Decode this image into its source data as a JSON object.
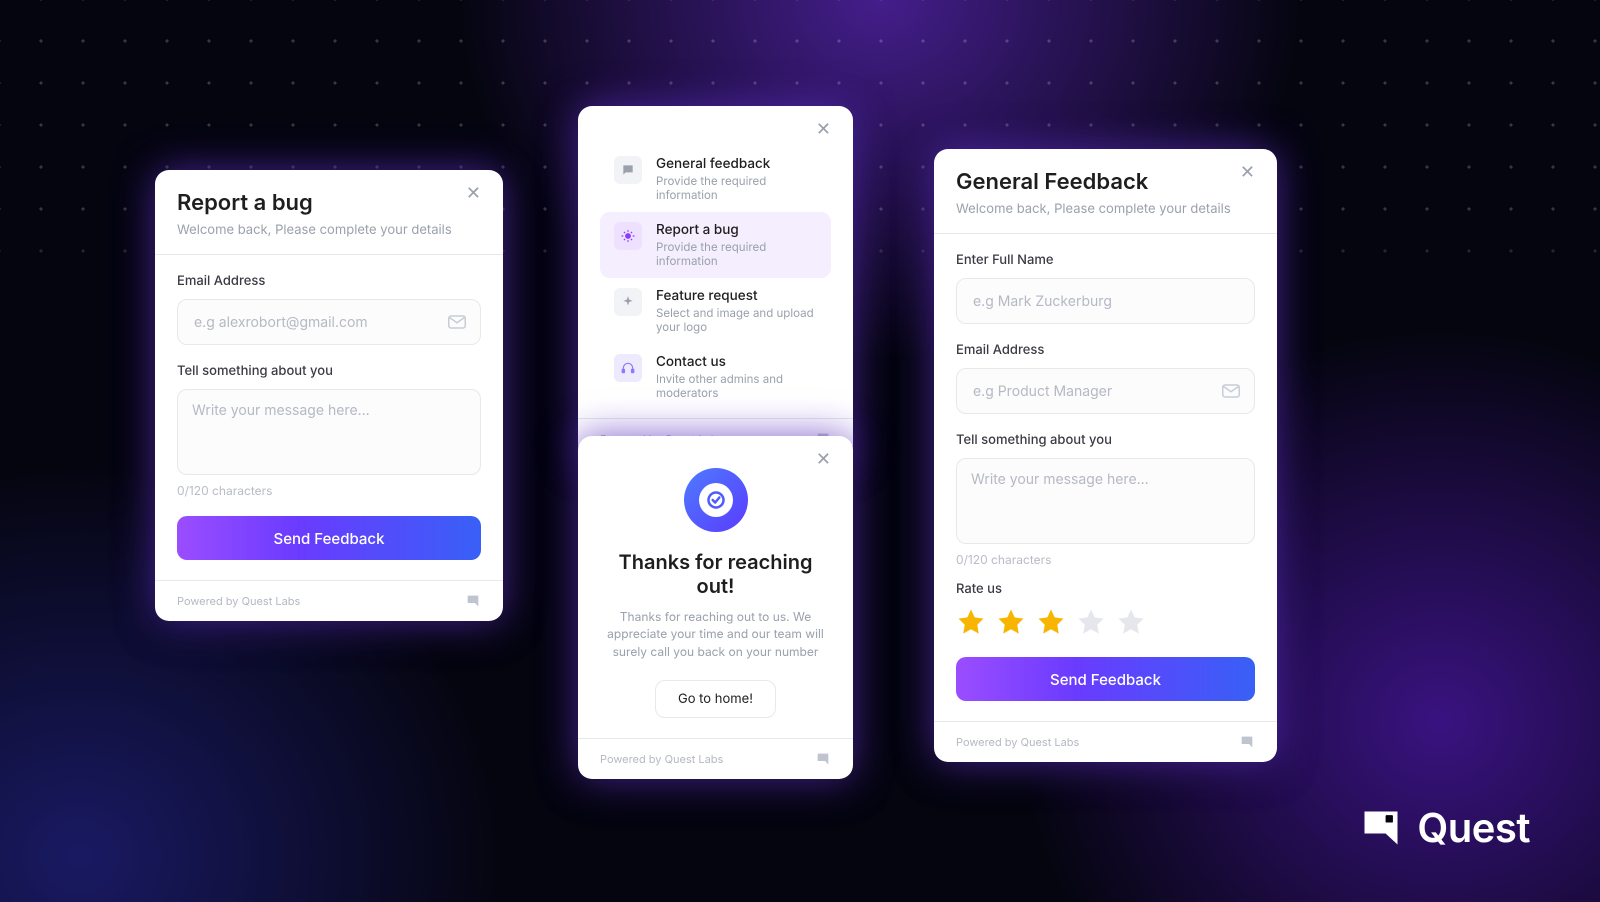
{
  "brand": {
    "name": "Quest"
  },
  "footer_text": "Powered by Quest Labs",
  "card_bug": {
    "title": "Report a bug",
    "subtitle": "Welcome back, Please complete your details",
    "email_label": "Email Address",
    "email_placeholder": "e.g alexrobort@gmail.com",
    "about_label": "Tell something about you",
    "about_placeholder": "Write your message here...",
    "counter": "0/120 characters",
    "submit": "Send Feedback"
  },
  "card_menu": {
    "items": [
      {
        "title": "General feedback",
        "subtitle": "Provide the required information",
        "icon": "chat-icon",
        "selected": false
      },
      {
        "title": "Report a bug",
        "subtitle": "Provide the required information",
        "icon": "bug-icon",
        "selected": true
      },
      {
        "title": "Feature request",
        "subtitle": "Select and image and upload your logo",
        "icon": "sparkle-icon",
        "selected": false
      },
      {
        "title": "Contact us",
        "subtitle": "Invite other admins and moderators",
        "icon": "headset-icon",
        "selected": false
      }
    ]
  },
  "card_thanks": {
    "title": "Thanks for reaching out!",
    "body": "Thanks for reaching out to us. We appreciate your time and our team will surely call you back on your number",
    "button": "Go to home!"
  },
  "card_general": {
    "title": "General Feedback",
    "subtitle": "Welcome back, Please complete your details",
    "name_label": "Enter Full Name",
    "name_placeholder": "e.g Mark Zuckerburg",
    "email_label": "Email Address",
    "email_placeholder": "e.g Product Manager",
    "about_label": "Tell something about you",
    "about_placeholder": "Write your message here...",
    "counter": "0/120 characters",
    "rate_label": "Rate us",
    "rating": 3,
    "submit": "Send Feedback"
  }
}
